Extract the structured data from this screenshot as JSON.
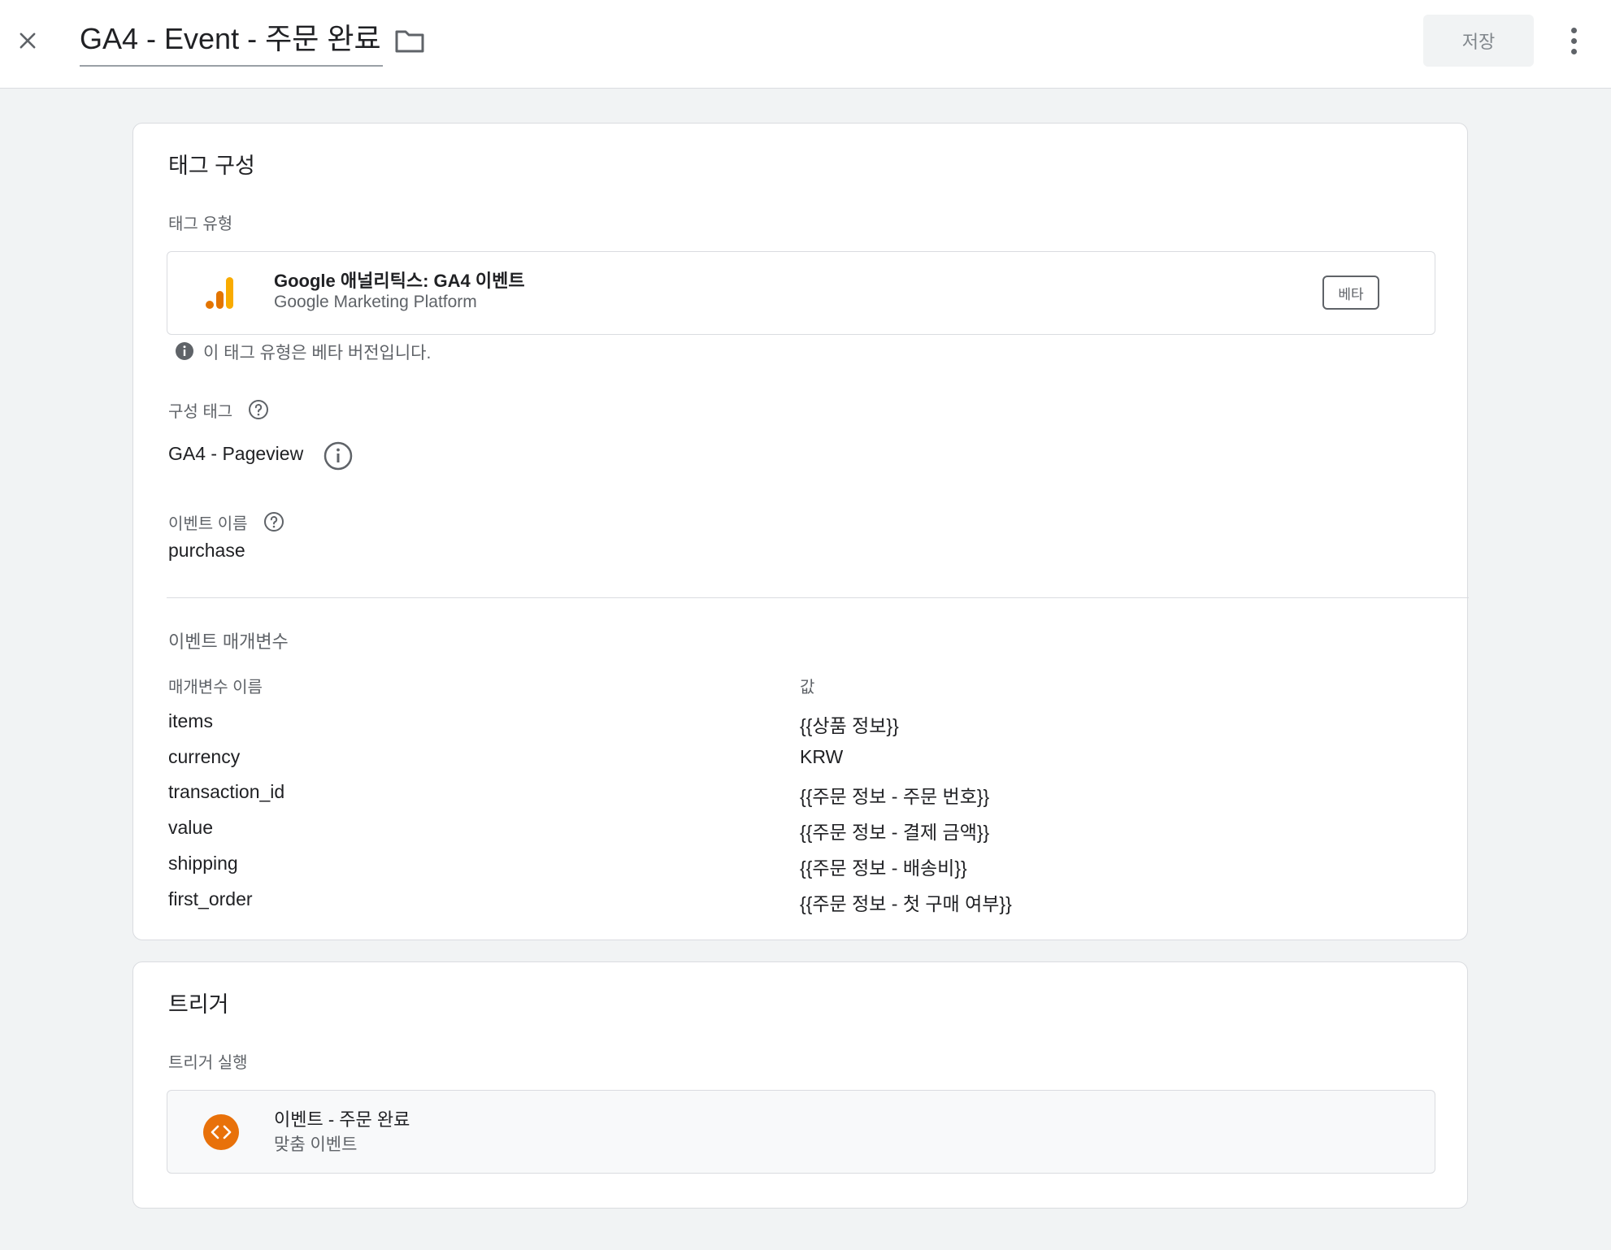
{
  "header": {
    "title": "GA4 - Event - 주문 완료",
    "save_label": "저장"
  },
  "tag_config": {
    "section_title": "태그 구성",
    "tag_type_label": "태그 유형",
    "tag_type": {
      "name": "Google 애널리틱스: GA4 이벤트",
      "platform": "Google Marketing Platform",
      "badge": "베타"
    },
    "beta_notice": "이 태그 유형은 베타 버전입니다.",
    "config_tag_label": "구성 태그",
    "config_tag_value": "GA4 - Pageview",
    "event_name_label": "이벤트 이름",
    "event_name_value": "purchase",
    "event_params_title": "이벤트 매개변수",
    "param_name_header": "매개변수 이름",
    "param_value_header": "값",
    "params": [
      {
        "name": "items",
        "value": "{{상품 정보}}"
      },
      {
        "name": "currency",
        "value": "KRW"
      },
      {
        "name": "transaction_id",
        "value": "{{주문 정보 - 주문 번호}}"
      },
      {
        "name": "value",
        "value": "{{주문 정보 - 결제 금액}}"
      },
      {
        "name": "shipping",
        "value": "{{주문 정보 - 배송비}}"
      },
      {
        "name": "first_order",
        "value": "{{주문 정보 - 첫 구매 여부}}"
      }
    ]
  },
  "triggering": {
    "section_title": "트리거",
    "firing_label": "트리거 실행",
    "trigger": {
      "name": "이벤트 - 주문 완료",
      "type": "맞춤 이벤트"
    }
  },
  "colors": {
    "ga_orange_dark": "#e37400",
    "ga_orange_light": "#f9ab00",
    "trigger_orange": "#e8710a"
  }
}
